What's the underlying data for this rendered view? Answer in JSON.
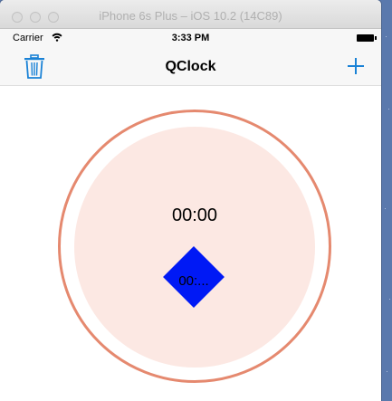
{
  "window": {
    "title": "iPhone 6s Plus – iOS 10.2 (14C89)"
  },
  "status_bar": {
    "carrier": "Carrier",
    "time": "3:33 PM"
  },
  "nav_bar": {
    "title": "QClock",
    "left_icon": "trash-icon",
    "right_icon": "plus-icon"
  },
  "clock": {
    "main_time": "00:00",
    "marker_label": "00:...",
    "colors": {
      "ring": "#e5896f",
      "disc": "#fce8e3",
      "marker": "#0019f5",
      "accent": "#1a82d6"
    }
  }
}
